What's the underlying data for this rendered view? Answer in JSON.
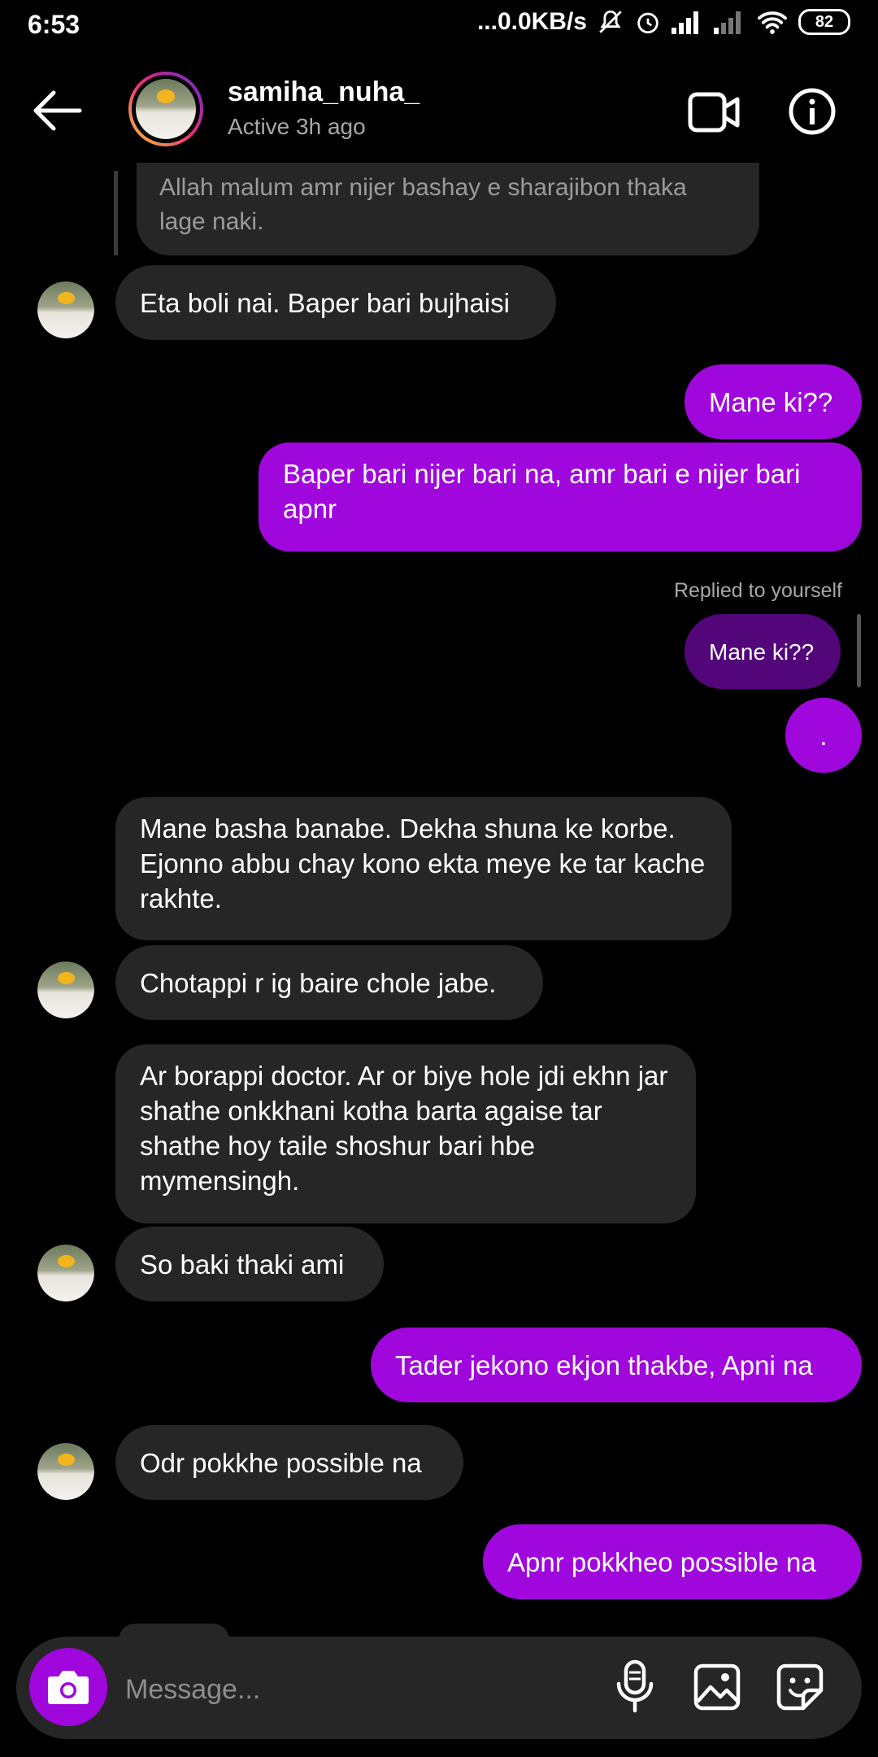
{
  "status_bar": {
    "time": "6:53",
    "network_speed": "...0.0KB/s",
    "battery": "82"
  },
  "header": {
    "username": "samiha_nuha_",
    "status": "Active 3h ago"
  },
  "quoted_message": "Allah malum amr nijer bashay e sharajibon thaka lage naki.",
  "messages": [
    {
      "from": "them",
      "text": "Eta boli nai. Baper bari bujhaisi"
    },
    {
      "from": "me",
      "text": "Mane ki??"
    },
    {
      "from": "me",
      "text": "Baper bari nijer bari na, amr bari e nijer bari apnr"
    },
    {
      "from": "me",
      "reply_label": "Replied to yourself",
      "quoted": "Mane ki??",
      "text": "."
    },
    {
      "from": "them",
      "text": "Mane basha banabe. Dekha shuna ke korbe. Ejonno abbu chay kono ekta meye ke tar kache rakhte."
    },
    {
      "from": "them",
      "text": "Chotappi r ig baire chole jabe."
    },
    {
      "from": "them",
      "text": "Ar borappi doctor. Ar or biye hole jdi ekhn jar shathe onkkhani kotha barta agaise tar shathe hoy taile shoshur bari hbe mymensingh."
    },
    {
      "from": "them",
      "text": "So baki thaki ami"
    },
    {
      "from": "me",
      "text": "Tader jekono ekjon thakbe, Apni na"
    },
    {
      "from": "them",
      "text": "Odr pokkhe possible na"
    },
    {
      "from": "me",
      "text": "Apnr pokkheo possible na"
    }
  ],
  "composer": {
    "placeholder": "Message..."
  },
  "colors": {
    "outgoing": "#a007dd",
    "incoming": "#262626",
    "reply_original": "#52067a",
    "background": "#000000"
  },
  "icons": [
    "back-arrow-icon",
    "video-call-icon",
    "info-icon",
    "camera-icon",
    "microphone-icon",
    "gallery-icon",
    "sticker-icon"
  ]
}
